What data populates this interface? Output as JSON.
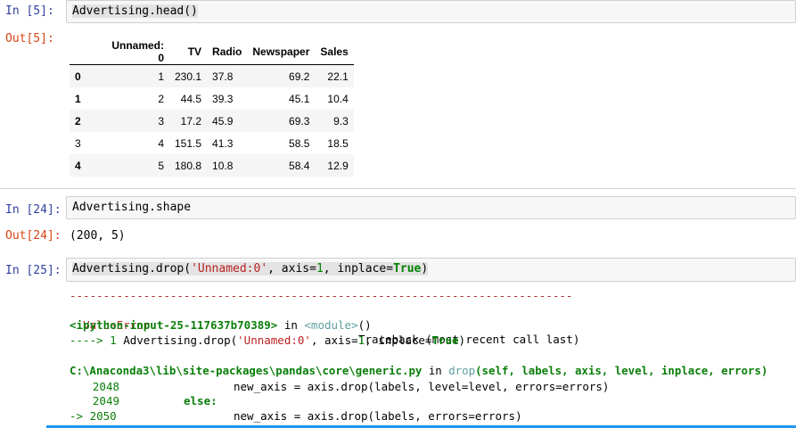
{
  "cell5": {
    "in_prompt": "In [5]:",
    "code": "Advertising.head()",
    "out_prompt": "Out[5]:",
    "table": {
      "columns": [
        "",
        "Unnamed: 0",
        "TV",
        "Radio",
        "Newspaper",
        "Sales"
      ],
      "rows": [
        [
          "0",
          "1",
          "230.1",
          "37.8",
          "69.2",
          "22.1"
        ],
        [
          "1",
          "2",
          "44.5",
          "39.3",
          "45.1",
          "10.4"
        ],
        [
          "2",
          "3",
          "17.2",
          "45.9",
          "69.3",
          "9.3"
        ],
        [
          "3",
          "4",
          "151.5",
          "41.3",
          "58.5",
          "18.5"
        ],
        [
          "4",
          "5",
          "180.8",
          "10.8",
          "58.4",
          "12.9"
        ]
      ]
    }
  },
  "cell24": {
    "in_prompt": "In [24]:",
    "code": "Advertising.shape",
    "out_prompt": "Out[24]:",
    "output": "(200, 5)"
  },
  "cell25": {
    "in_prompt": "In [25]:",
    "code_prefix": "Advertising.drop(",
    "code_str": "'Unnamed:0'",
    "code_mid": ", axis=",
    "code_num": "1",
    "code_mid2": ", inplace=",
    "code_kw": "True",
    "code_suffix": ")",
    "traceback": {
      "dashes": "---------------------------------------------------------------------------",
      "error_name": "ValueError",
      "header_right": "Traceback (most recent call last)",
      "input_ref": "<ipython-input-25-117637b70389>",
      "in_word": " in ",
      "module": "<module>",
      "module_suffix": "()",
      "arrow1_prefix": "----> 1 ",
      "arrow1_code_prefix": "Advertising.drop(",
      "arrow1_str": "'Unnamed:0'",
      "arrow1_mid": ", axis=",
      "arrow1_num": "1",
      "arrow1_mid2": ", inplace=",
      "arrow1_kw": "True",
      "arrow1_suffix": ")",
      "file_path": "C:\\Anaconda3\\lib\\site-packages\\pandas\\core\\generic.py",
      "func_name": "drop",
      "func_args": "(self, labels, axis, level, inplace, errors)",
      "line2048_num": "2048",
      "line2048_code": "new_axis = axis.drop(labels, level=level, errors=errors)",
      "line2049_num": "2049",
      "line2049_code": "else:",
      "line2050_arrow": "-> 2050",
      "line2050_code": "new_axis = axis.drop(labels, errors=errors)"
    }
  }
}
